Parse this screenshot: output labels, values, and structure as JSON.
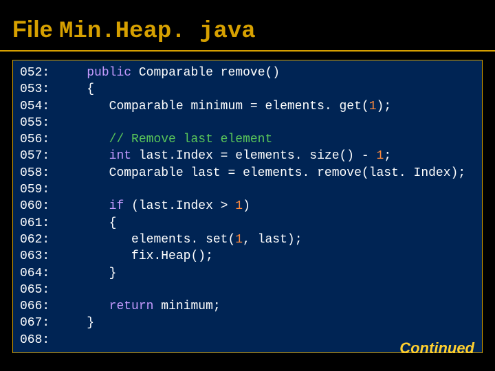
{
  "title_prefix": "File ",
  "title_file": "Min.Heap. java",
  "continued_label": "Continued",
  "code_lines": [
    {
      "n": "052:",
      "segs": [
        {
          "c": "sp",
          "t": "   "
        },
        {
          "c": "kw",
          "t": "public"
        },
        {
          "c": "sp",
          "t": " "
        },
        {
          "c": "typ",
          "t": "Comparable remove()"
        }
      ]
    },
    {
      "n": "053:",
      "segs": [
        {
          "c": "sp",
          "t": "   "
        },
        {
          "c": "typ",
          "t": "{"
        }
      ]
    },
    {
      "n": "054:",
      "segs": [
        {
          "c": "sp",
          "t": "      "
        },
        {
          "c": "typ",
          "t": "Comparable minimum = elements. get("
        },
        {
          "c": "num",
          "t": "1"
        },
        {
          "c": "typ",
          "t": ");"
        }
      ]
    },
    {
      "n": "055:",
      "segs": []
    },
    {
      "n": "056:",
      "segs": [
        {
          "c": "sp",
          "t": "      "
        },
        {
          "c": "cmt",
          "t": "// Remove last element"
        }
      ]
    },
    {
      "n": "057:",
      "segs": [
        {
          "c": "sp",
          "t": "      "
        },
        {
          "c": "kw",
          "t": "int"
        },
        {
          "c": "sp",
          "t": " "
        },
        {
          "c": "typ",
          "t": "last.Index = elements. size() - "
        },
        {
          "c": "num",
          "t": "1"
        },
        {
          "c": "typ",
          "t": ";"
        }
      ]
    },
    {
      "n": "058:",
      "segs": [
        {
          "c": "sp",
          "t": "      "
        },
        {
          "c": "typ",
          "t": "Comparable last = elements. remove(last. Index);"
        }
      ]
    },
    {
      "n": "059:",
      "segs": []
    },
    {
      "n": "060:",
      "segs": [
        {
          "c": "sp",
          "t": "      "
        },
        {
          "c": "kw",
          "t": "if"
        },
        {
          "c": "sp",
          "t": " "
        },
        {
          "c": "typ",
          "t": "(last.Index > "
        },
        {
          "c": "num",
          "t": "1"
        },
        {
          "c": "typ",
          "t": ")"
        }
      ]
    },
    {
      "n": "061:",
      "segs": [
        {
          "c": "sp",
          "t": "      "
        },
        {
          "c": "typ",
          "t": "{"
        }
      ]
    },
    {
      "n": "062:",
      "segs": [
        {
          "c": "sp",
          "t": "         "
        },
        {
          "c": "typ",
          "t": "elements. set("
        },
        {
          "c": "num",
          "t": "1"
        },
        {
          "c": "typ",
          "t": ", last);"
        }
      ]
    },
    {
      "n": "063:",
      "segs": [
        {
          "c": "sp",
          "t": "         "
        },
        {
          "c": "typ",
          "t": "fix.Heap();"
        }
      ]
    },
    {
      "n": "064:",
      "segs": [
        {
          "c": "sp",
          "t": "      "
        },
        {
          "c": "typ",
          "t": "}"
        }
      ]
    },
    {
      "n": "065:",
      "segs": []
    },
    {
      "n": "066:",
      "segs": [
        {
          "c": "sp",
          "t": "      "
        },
        {
          "c": "kw",
          "t": "return"
        },
        {
          "c": "sp",
          "t": " "
        },
        {
          "c": "typ",
          "t": "minimum;"
        }
      ]
    },
    {
      "n": "067:",
      "segs": [
        {
          "c": "sp",
          "t": "   "
        },
        {
          "c": "typ",
          "t": "}"
        }
      ]
    },
    {
      "n": "068:",
      "segs": []
    }
  ]
}
